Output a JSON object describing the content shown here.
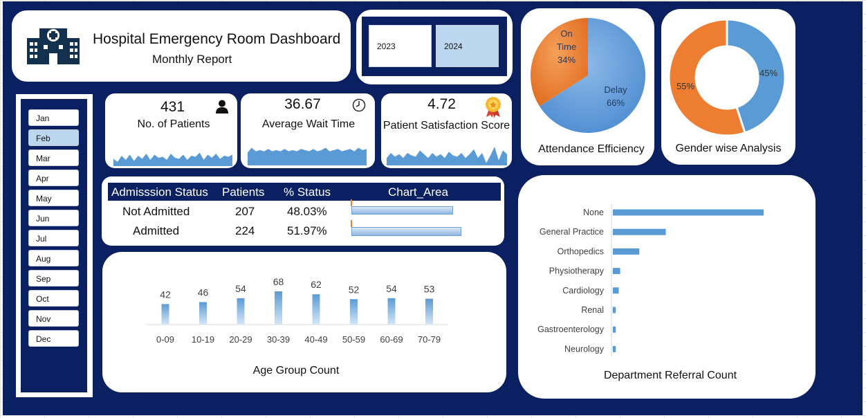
{
  "header": {
    "title": "Hospital Emergency Room Dashboard",
    "subtitle": "Monthly Report"
  },
  "years": [
    "2023",
    "2024"
  ],
  "selected_year": "2024",
  "months": [
    "Jan",
    "Feb",
    "Mar",
    "Apr",
    "May",
    "Jun",
    "Jul",
    "Aug",
    "Sep",
    "Oct",
    "Nov",
    "Dec"
  ],
  "selected_month": "Feb",
  "kpis": {
    "patients": {
      "value": "431",
      "label": "No. of Patients",
      "icon": "person-icon"
    },
    "wait": {
      "value": "36.67",
      "label": "Average Wait Time",
      "icon": "clock-icon"
    },
    "satisfaction": {
      "value": "4.72",
      "label": "Patient Satisfaction Score",
      "icon": "award-badge-icon"
    }
  },
  "colors": {
    "navy": "#0a2060",
    "blue": "#5b9bd5",
    "orange": "#ed7d31",
    "light_blue": "#bdd7ee"
  },
  "admission_table": {
    "headers": [
      "Admisssion Status",
      "Patients",
      "% Status",
      "Chart_Area"
    ],
    "rows": [
      {
        "status": "Not Admitted",
        "patients": "207",
        "pct": "48.03%",
        "value": 0.4803
      },
      {
        "status": "Admitted",
        "patients": "224",
        "pct": "51.97%",
        "value": 0.5197
      }
    ]
  },
  "chart_data": [
    {
      "type": "area",
      "description_id": "patients-sparkline",
      "values": [
        0.35,
        0.2,
        0.5,
        0.3,
        0.55,
        0.25,
        0.5,
        0.35,
        0.6,
        0.3,
        0.55,
        0.4,
        0.45,
        0.3,
        0.6,
        0.4,
        0.35,
        0.55,
        0.3,
        0.5,
        0.45,
        0.65,
        0.3,
        0.55,
        0.4,
        0.6,
        0.35,
        0.5,
        0.45,
        0.55
      ]
    },
    {
      "type": "area",
      "description_id": "wait-time-sparkline",
      "values": [
        0.55,
        0.75,
        0.6,
        0.65,
        0.6,
        0.7,
        0.6,
        0.65,
        0.6,
        0.7,
        0.6,
        0.65,
        0.6,
        0.7,
        0.65,
        0.6,
        0.7,
        0.6,
        0.65,
        0.75,
        0.6,
        0.65,
        0.7,
        0.6,
        0.65,
        0.7,
        0.6,
        0.75,
        0.65,
        0.7
      ]
    },
    {
      "type": "area",
      "description_id": "satisfaction-sparkline",
      "values": [
        0.3,
        0.5,
        0.35,
        0.45,
        0.3,
        0.5,
        0.4,
        0.35,
        0.6,
        0.45,
        0.3,
        0.5,
        0.35,
        0.45,
        0.3,
        0.55,
        0.4,
        0.35,
        0.5,
        0.3,
        0.45,
        0.65,
        0.3,
        0.5,
        0.1,
        0.4,
        0.75,
        0.2,
        0.6,
        0.45
      ]
    },
    {
      "type": "pie",
      "title": "Attendance Efficiency",
      "slices": [
        {
          "label": "On Time",
          "value": 34,
          "display": "34%",
          "color": "#ed7d31"
        },
        {
          "label": "Delay",
          "value": 66,
          "display": "66%",
          "color": "#5b9bd5"
        }
      ]
    },
    {
      "type": "pie",
      "title": "Gender wise Analysis",
      "donut": true,
      "slices": [
        {
          "value": 45,
          "display": "45%",
          "color": "#5b9bd5"
        },
        {
          "value": 55,
          "display": "55%",
          "color": "#ed7d31"
        }
      ]
    },
    {
      "type": "bar",
      "title": "Age Group Count",
      "categories": [
        "0-09",
        "10-19",
        "20-29",
        "30-39",
        "40-49",
        "50-59",
        "60-69",
        "70-79"
      ],
      "values": [
        42,
        46,
        54,
        68,
        62,
        52,
        54,
        53
      ],
      "data_labels": true,
      "ylim": [
        0,
        68
      ]
    },
    {
      "type": "bar",
      "orientation": "horizontal",
      "title": "Department Referral Count",
      "categories": [
        "None",
        "General Practice",
        "Orthopedics",
        "Physiotherapy",
        "Cardiology",
        "Renal",
        "Gastroenterology",
        "Neurology"
      ],
      "values": [
        205,
        72,
        36,
        10,
        8,
        4,
        4,
        4
      ]
    }
  ],
  "labels": {
    "attendance": "Attendance Efficiency",
    "gender": "Gender wise Analysis",
    "age": "Age Group Count",
    "dept": "Department Referral Count",
    "on_time_line1": "On",
    "on_time_line2": "Time",
    "on_time_pct": "34%",
    "delay_line1": "Delay",
    "delay_pct": "66%",
    "gender_45": "45%",
    "gender_55": "55%"
  }
}
